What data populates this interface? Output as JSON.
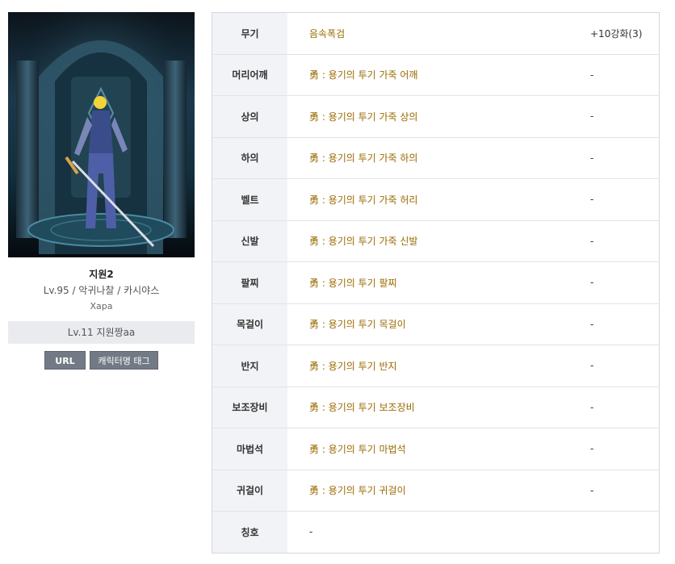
{
  "character": {
    "name": "지원2",
    "info": "Lv.95 / 악귀나찰 / 카시야스",
    "server": "Xapa",
    "guild": "Lv.11 지원짱aa"
  },
  "buttons": {
    "url": "URL",
    "tag": "캐릭터명 태그"
  },
  "equipment": [
    {
      "slot": "무기",
      "item": "음속폭검",
      "enhance": "+10강화(3)"
    },
    {
      "slot": "머리어깨",
      "item": "勇 : 용기의 투기 가죽 어깨",
      "enhance": "-"
    },
    {
      "slot": "상의",
      "item": "勇 : 용기의 투기 가죽 상의",
      "enhance": "-"
    },
    {
      "slot": "하의",
      "item": "勇 : 용기의 투기 가죽 하의",
      "enhance": "-"
    },
    {
      "slot": "벨트",
      "item": "勇 : 용기의 투기 가죽 허리",
      "enhance": "-"
    },
    {
      "slot": "신발",
      "item": "勇 : 용기의 투기 가죽 신발",
      "enhance": "-"
    },
    {
      "slot": "팔찌",
      "item": "勇 : 용기의 투기 팔찌",
      "enhance": "-"
    },
    {
      "slot": "목걸이",
      "item": "勇 : 용기의 투기 목걸이",
      "enhance": "-"
    },
    {
      "slot": "반지",
      "item": "勇 : 용기의 투기 반지",
      "enhance": "-"
    },
    {
      "slot": "보조장비",
      "item": "勇 : 용기의 투기 보조장비",
      "enhance": "-"
    },
    {
      "slot": "마법석",
      "item": "勇 : 용기의 투기 마법석",
      "enhance": "-"
    },
    {
      "slot": "귀걸이",
      "item": "勇 : 용기의 투기 귀걸이",
      "enhance": "-"
    },
    {
      "slot": "칭호",
      "item": "-",
      "enhance": ""
    }
  ],
  "colors": {
    "item_text": "#9a6a00",
    "slot_bg": "#f2f3f6",
    "button_bg": "#727a85",
    "guild_bg": "#e9ebef"
  }
}
